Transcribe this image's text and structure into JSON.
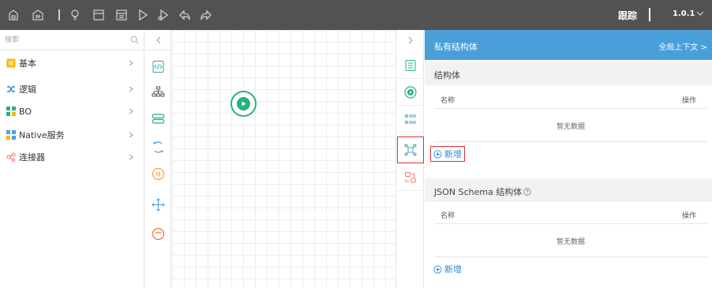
{
  "toolbar": {
    "trace_label": "跟踪",
    "version": "1.0.1",
    "icons": [
      "save-icon",
      "save-as-icon",
      "separator",
      "hint-icon",
      "document-icon",
      "deploy-icon",
      "run-icon",
      "debug-icon",
      "undo-icon",
      "redo-icon"
    ]
  },
  "left_panel": {
    "search_placeholder": "搜索",
    "categories": [
      {
        "label": "基本",
        "icon": "basic-icon",
        "color": "#f5b800"
      },
      {
        "label": "逻辑",
        "icon": "logic-icon",
        "color": "#2a8ad8"
      },
      {
        "label": "BO",
        "icon": "bo-icon",
        "color": "#26b37a"
      },
      {
        "label": "Native服务",
        "icon": "native-service-icon",
        "color": "#4a9fda"
      },
      {
        "label": "连接器",
        "icon": "connector-icon",
        "color": "#f07070"
      }
    ]
  },
  "palette": {
    "collapse": "<",
    "items": [
      "script-icon",
      "tree-icon",
      "storage-icon",
      "loop-icon",
      "pause-icon",
      "move-icon",
      "timer-icon"
    ]
  },
  "properties_column": {
    "collapse": ">",
    "items": [
      "properties-icon",
      "start-icon",
      "list-icon",
      "struct-icon",
      "mapping-icon"
    ],
    "active_index": 3
  },
  "right_panel": {
    "title": "私有结构体",
    "global_context": "全局上下文 >",
    "struct_section": {
      "title": "结构体",
      "col_name": "名称",
      "col_op": "操作",
      "empty": "暂无数据",
      "add": "新增"
    },
    "schema_section": {
      "title": "JSON Schema 结构体",
      "col_name": "名称",
      "col_op": "操作",
      "empty": "暂无数据",
      "add": "新增"
    }
  },
  "colors": {
    "toolbar_bg": "#525252",
    "header_blue": "#4a9fda",
    "accent_green": "#26b37a",
    "accent_orange": "#f5a623",
    "link_blue": "#2a8ad8",
    "highlight_red": "#e03030"
  }
}
